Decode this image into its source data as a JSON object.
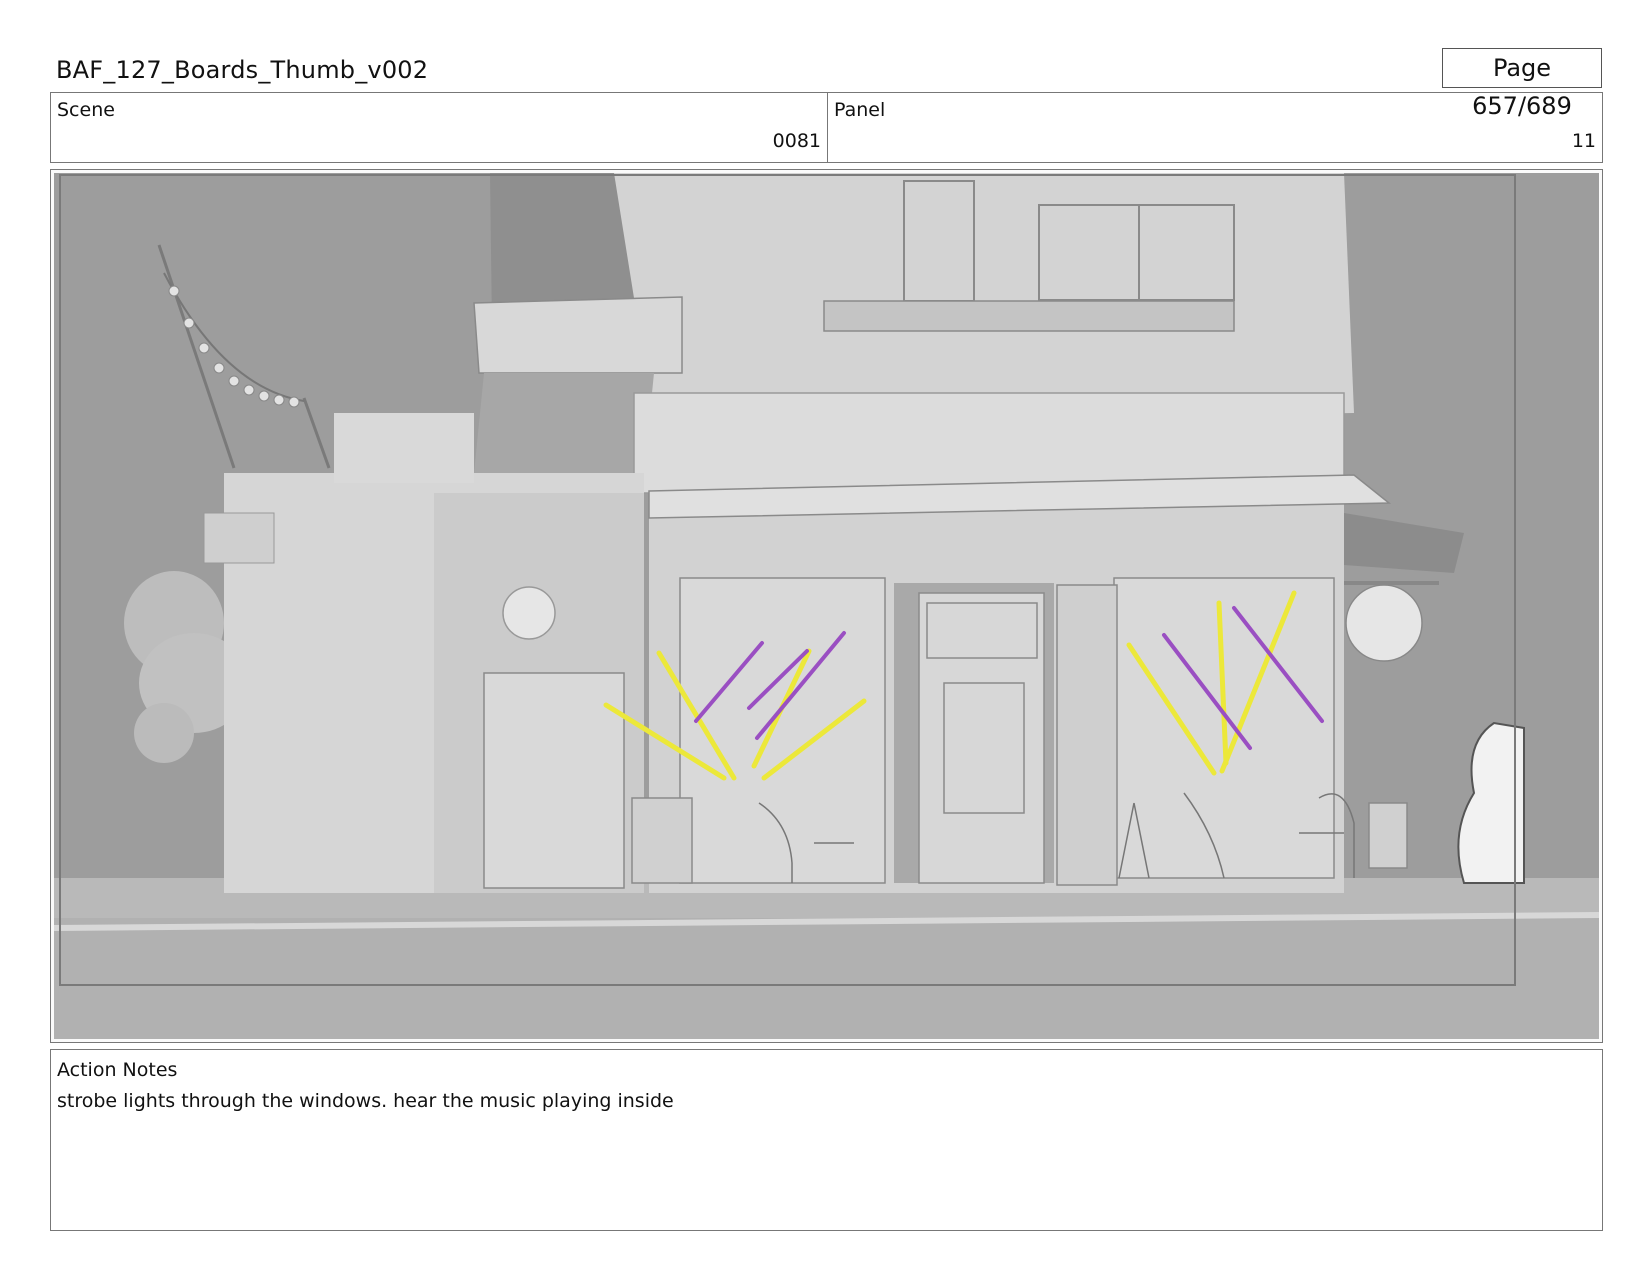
{
  "header": {
    "title": "BAF_127_Boards_Thumb_v002",
    "page": "Page 657/689"
  },
  "info": {
    "scene_label": "Scene",
    "scene_value": "0081",
    "panel_label": "Panel",
    "panel_value": "11"
  },
  "frame": {
    "strobe_colors": [
      "#ece83a",
      "#9a4fc2"
    ],
    "background_color": "#9f9f9f"
  },
  "notes": {
    "label": "Action Notes",
    "text": "strobe lights through the windows. hear the music playing inside"
  }
}
